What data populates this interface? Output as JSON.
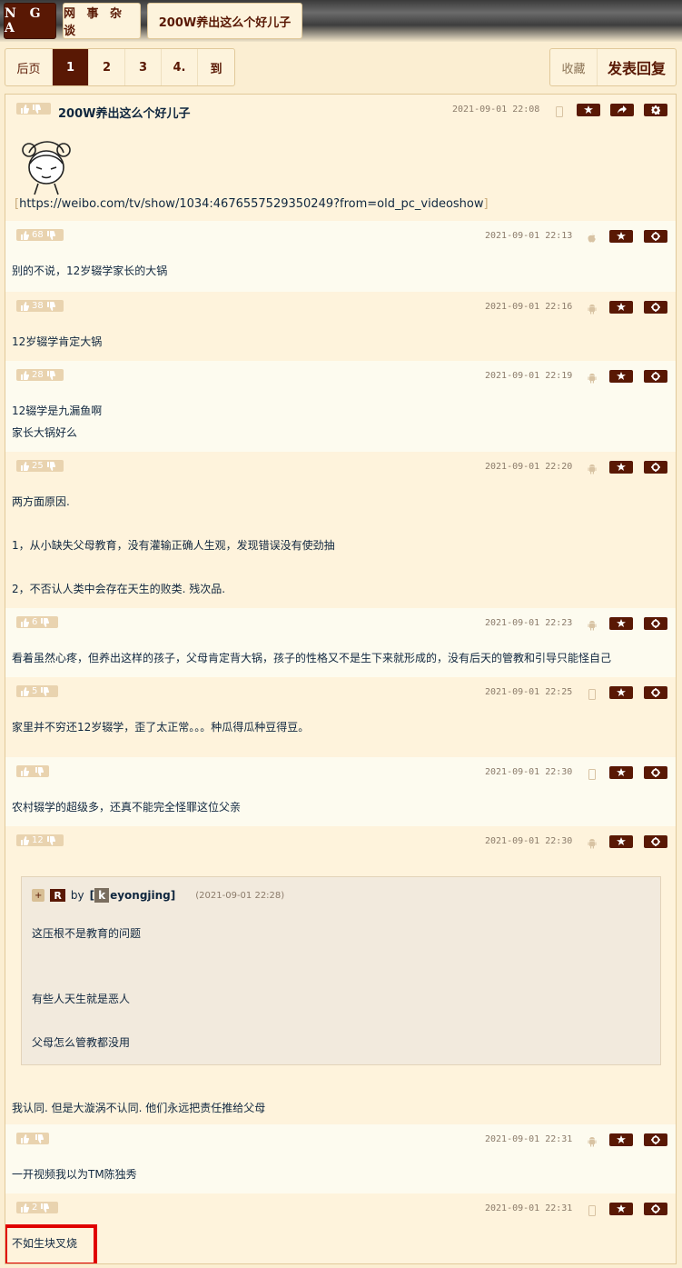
{
  "breadcrumb": {
    "logo": "N G A",
    "forum": "网 事 杂 谈",
    "thread": "200W养出这么个好儿子"
  },
  "pager": {
    "first": "后页",
    "pages": [
      "1",
      "2",
      "3",
      "4."
    ],
    "goto": "到"
  },
  "actions": {
    "favorite": "收藏",
    "reply": "发表回复"
  },
  "colors": {
    "accent": "#591804",
    "background": "#fbeed2",
    "highlight": "#e00000"
  },
  "op": {
    "title": "200W养出这么个好儿子",
    "date": "2021-09-01 22:08",
    "device": "mobile-icon",
    "link_open": "[",
    "link": "https://weibo.com/tv/show/1034:4676557529350249?from=old_pc_videoshow",
    "link_close": "]"
  },
  "replies": [
    {
      "likes": "68",
      "date": "2021-09-01 22:13",
      "device": "apple-icon",
      "text": "别的不说，12岁辍学家长的大锅"
    },
    {
      "likes": "38",
      "date": "2021-09-01 22:16",
      "device": "android-icon",
      "text": "12岁辍学肯定大锅"
    },
    {
      "likes": "28",
      "date": "2021-09-01 22:19",
      "device": "android-icon",
      "text": "12辍学是九漏鱼啊\n家长大锅好么"
    },
    {
      "likes": "25",
      "date": "2021-09-01 22:20",
      "device": "android-icon",
      "text": "两方面原因.\n\n1，从小缺失父母教育，没有灌输正确人生观，发现错误没有使劲抽\n\n2，不否认人类中会存在天生的败类. 残次品."
    },
    {
      "likes": "6",
      "date": "2021-09-01 22:23",
      "device": "android-icon",
      "text": "看着虽然心疼，但养出这样的孩子，父母肯定背大锅，孩子的性格又不是生下来就形成的，没有后天的管教和引导只能怪自己"
    },
    {
      "likes": "5",
      "date": "2021-09-01 22:25",
      "device": "mobile-icon",
      "text": "家里并不穷还12岁辍学，歪了太正常。。。种瓜得瓜种豆得豆。"
    },
    {
      "likes": "",
      "date": "2021-09-01 22:30",
      "device": "mobile-icon",
      "text": "农村辍学的超级多，还真不能完全怪罪这位父亲"
    },
    {
      "likes": "12",
      "date": "2021-09-01 22:30",
      "device": "android-icon",
      "text": "我认同. 但是大漩涡不认同. 他们永远把责任推给父母",
      "quote": {
        "plus": "+",
        "tag": "R",
        "by": "by",
        "open": "[",
        "initial": "k",
        "user": "eyongjing",
        "close": "]",
        "date": "(2021-09-01 22:28)",
        "text": "这压根不是教育的问题\n\n\n有些人天生就是恶人\n\n父母怎么管教都没用"
      }
    },
    {
      "likes": "",
      "date": "2021-09-01 22:31",
      "device": "android-icon",
      "text": "一开视频我以为TM陈独秀"
    },
    {
      "likes": "2",
      "date": "2021-09-01 22:31",
      "device": "mobile-icon",
      "text": "不如生块叉烧"
    }
  ]
}
